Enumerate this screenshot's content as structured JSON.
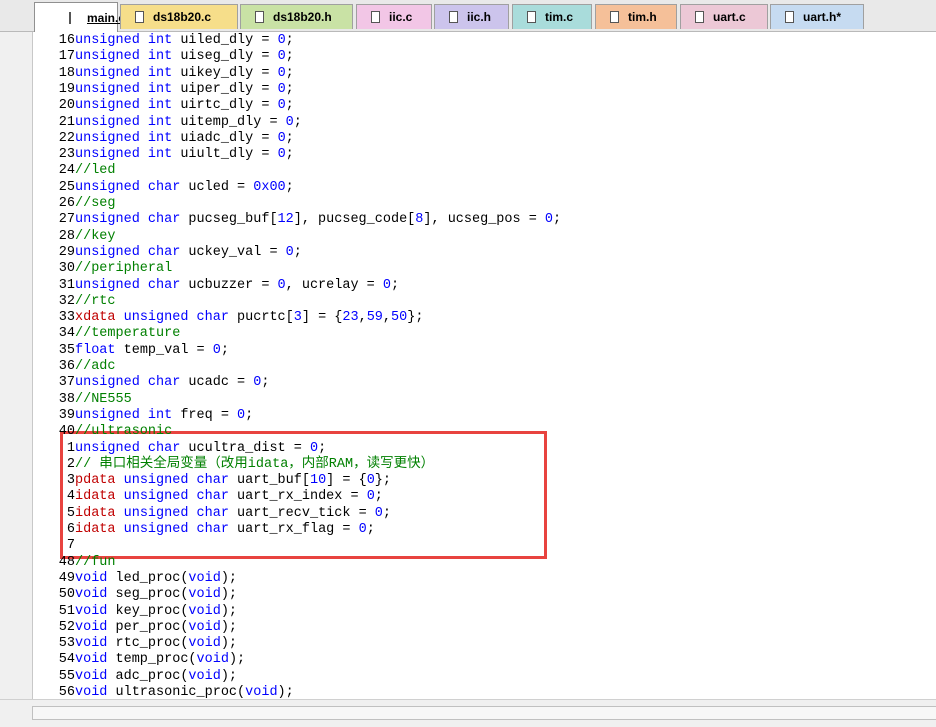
{
  "tabs": [
    {
      "label": "main.c",
      "color": "#ffffff",
      "active": true
    },
    {
      "label": "ds18b20.c",
      "color": "#f6de8a"
    },
    {
      "label": "ds18b20.h",
      "color": "#c9e2a5"
    },
    {
      "label": "iic.c",
      "color": "#f2c6e6"
    },
    {
      "label": "iic.h",
      "color": "#ccc4ec"
    },
    {
      "label": "tim.c",
      "color": "#a9dcdb"
    },
    {
      "label": "tim.h",
      "color": "#f5c099"
    },
    {
      "label": "uart.c",
      "color": "#ecc8d6"
    },
    {
      "label": "uart.h*",
      "color": "#c6dbf1"
    }
  ],
  "code": {
    "lines": [
      {
        "n": "16",
        "text": "unsigned int uiled_dly = 0;"
      },
      {
        "n": "17",
        "text": "unsigned int uiseg_dly = 0;"
      },
      {
        "n": "18",
        "text": "unsigned int uikey_dly = 0;"
      },
      {
        "n": "19",
        "text": "unsigned int uiper_dly = 0;"
      },
      {
        "n": "20",
        "text": "unsigned int uirtc_dly = 0;"
      },
      {
        "n": "21",
        "text": "unsigned int uitemp_dly = 0;"
      },
      {
        "n": "22",
        "text": "unsigned int uiadc_dly = 0;"
      },
      {
        "n": "23",
        "text": "unsigned int uiult_dly = 0;"
      },
      {
        "n": "24",
        "text": "//led"
      },
      {
        "n": "25",
        "text": "unsigned char ucled = 0x00;"
      },
      {
        "n": "26",
        "text": "//seg"
      },
      {
        "n": "27",
        "text": "unsigned char pucseg_buf[12], pucseg_code[8], ucseg_pos = 0;"
      },
      {
        "n": "28",
        "text": "//key"
      },
      {
        "n": "29",
        "text": "unsigned char uckey_val = 0;"
      },
      {
        "n": "30",
        "text": "//peripheral"
      },
      {
        "n": "31",
        "text": "unsigned char ucbuzzer = 0, ucrelay = 0;"
      },
      {
        "n": "32",
        "text": "//rtc"
      },
      {
        "n": "33",
        "text": "xdata unsigned char pucrtc[3] = {23,59,50};"
      },
      {
        "n": "34",
        "text": "//temperature"
      },
      {
        "n": "35",
        "text": "float temp_val = 0;"
      },
      {
        "n": "36",
        "text": "//adc"
      },
      {
        "n": "37",
        "text": "unsigned char ucadc = 0;"
      },
      {
        "n": "38",
        "text": "//NE555"
      },
      {
        "n": "39",
        "text": "unsigned int freq = 0;"
      },
      {
        "n": "40",
        "text": "//ultrasonic"
      },
      {
        "n": "1",
        "text": "unsigned char ucultra_dist = 0;"
      },
      {
        "n": "2",
        "text": "// 串口相关全局变量（改用idata，内部RAM，读写更快）"
      },
      {
        "n": "3",
        "text": "pdata unsigned char uart_buf[10] = {0};"
      },
      {
        "n": "4",
        "text": "idata unsigned char uart_rx_index = 0;"
      },
      {
        "n": "5",
        "text": "idata unsigned char uart_recv_tick = 0;"
      },
      {
        "n": "6",
        "text": "idata unsigned char uart_rx_flag = 0;"
      },
      {
        "n": "7",
        "text": ""
      },
      {
        "n": "48",
        "text": "//fun"
      },
      {
        "n": "49",
        "text": "void led_proc(void);"
      },
      {
        "n": "50",
        "text": "void seg_proc(void);"
      },
      {
        "n": "51",
        "text": "void key_proc(void);"
      },
      {
        "n": "52",
        "text": "void per_proc(void);"
      },
      {
        "n": "53",
        "text": "void rtc_proc(void);"
      },
      {
        "n": "54",
        "text": "void temp_proc(void);"
      },
      {
        "n": "55",
        "text": "void adc_proc(void);"
      },
      {
        "n": "56",
        "text": "void ultrasonic_proc(void);"
      }
    ]
  },
  "colors": {
    "keyword": "#0000ff",
    "comment": "#008000",
    "storage_qualifier": "#c00000",
    "highlight_box": "#e8433f"
  }
}
